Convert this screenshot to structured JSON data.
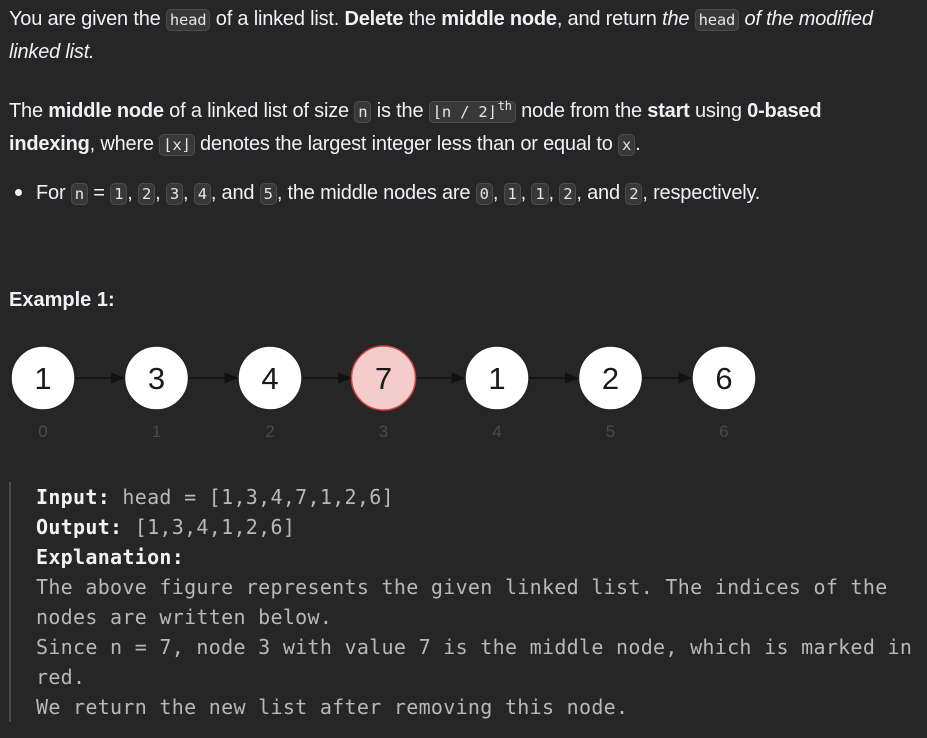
{
  "intro": {
    "t1": "You are given the ",
    "c1": "head",
    "t2": " of a linked list. ",
    "b1": "Delete",
    "t3": " the ",
    "b2": "middle node",
    "t4": ", and return ",
    "i1": "the ",
    "c2": "head",
    "i2": " of the modified linked list."
  },
  "definition": {
    "t1": "The ",
    "b1": "middle node",
    "t2": " of a linked list of size ",
    "c1": "n",
    "t3": " is the ",
    "c2": "⌊n / 2⌋",
    "sup": "th",
    "t4": " node from the ",
    "b2": "start",
    "t5": " using ",
    "b3": "0-based indexing",
    "t6": ", where ",
    "c3": "⌊x⌋",
    "t7": " denotes the largest integer less than or equal to ",
    "c4": "x",
    "t8": "."
  },
  "bullet": {
    "t1": "For ",
    "n": "n",
    "eq": " = ",
    "v1": "1",
    "v2": "2",
    "v3": "3",
    "v4": "4",
    "v5": "5",
    "and": ", and ",
    "comma": ", ",
    "mid": ", the middle nodes are ",
    "m1": "0",
    "m2": "1",
    "m3": "1",
    "m4": "2",
    "m5": "2",
    "end": ", respectively."
  },
  "example": {
    "title": "Example 1:",
    "input_label": "Input:",
    "input_value": " head = [1,3,4,7,1,2,6]",
    "output_label": "Output:",
    "output_value": " [1,3,4,1,2,6]",
    "explanation_label": "Explanation:",
    "explanation_line1": "The above figure represents the given linked list. The indices of the nodes are written below.",
    "explanation_line2": "Since n = 7, node 3 with value 7 is the middle node, which is marked in red.",
    "explanation_line3": "We return the new list after removing this node."
  },
  "figure": {
    "middle_color": "#f4cccc",
    "middle_stroke": "#cc4444",
    "nodes": [
      {
        "value": "1",
        "index": "0",
        "middle": false
      },
      {
        "value": "3",
        "index": "1",
        "middle": false
      },
      {
        "value": "4",
        "index": "2",
        "middle": false
      },
      {
        "value": "7",
        "index": "3",
        "middle": true
      },
      {
        "value": "1",
        "index": "4",
        "middle": false
      },
      {
        "value": "2",
        "index": "5",
        "middle": false
      },
      {
        "value": "6",
        "index": "6",
        "middle": false
      }
    ]
  }
}
